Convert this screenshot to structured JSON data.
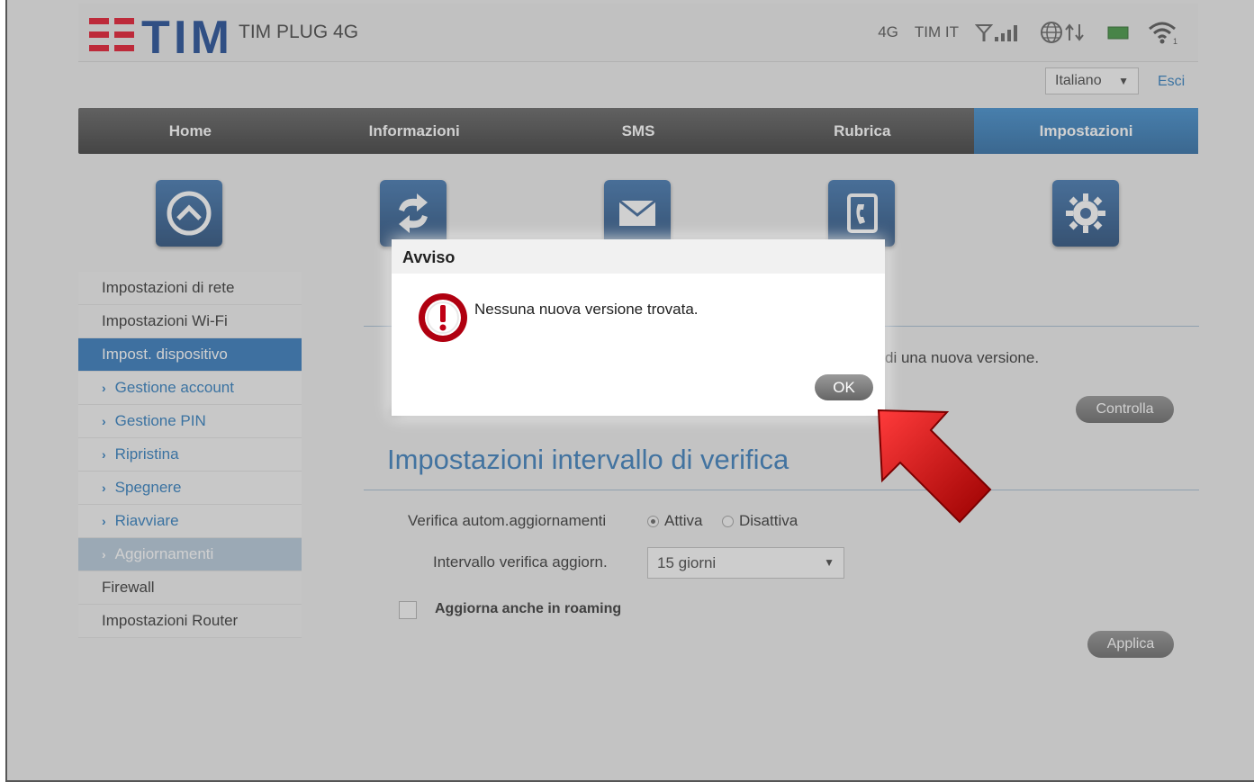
{
  "header": {
    "brand": "TIM",
    "device_name": "TIM PLUG 4G",
    "network_type": "4G",
    "operator": "TIM IT"
  },
  "language": {
    "selected": "Italiano",
    "logout": "Esci"
  },
  "nav": {
    "items": [
      {
        "label": "Home"
      },
      {
        "label": "Informazioni"
      },
      {
        "label": "SMS"
      },
      {
        "label": "Rubrica"
      },
      {
        "label": "Impostazioni"
      }
    ],
    "active": "Impostazioni"
  },
  "sidebar": {
    "items": [
      {
        "label": "Impostazioni di rete"
      },
      {
        "label": "Impostazioni Wi-Fi"
      },
      {
        "label": "Impost. dispositivo"
      },
      {
        "label": "Gestione account"
      },
      {
        "label": "Gestione PIN"
      },
      {
        "label": "Ripristina"
      },
      {
        "label": "Spegnere"
      },
      {
        "label": "Riavviare"
      },
      {
        "label": "Aggiornamenti"
      },
      {
        "label": "Firewall"
      },
      {
        "label": "Impostazioni Router"
      }
    ]
  },
  "main": {
    "check_text": "di una nuova versione.",
    "check_button": "Controlla",
    "section_title": "Impostazioni intervallo di verifica",
    "auto_update_label": "Verifica autom.aggiornamenti",
    "radio_on": "Attiva",
    "radio_off": "Disattiva",
    "interval_label": "Intervallo verifica aggiorn.",
    "interval_value": "15 giorni",
    "roaming_label": "Aggiorna anche in roaming",
    "apply_button": "Applica"
  },
  "dialog": {
    "title": "Avviso",
    "message": "Nessuna nuova versione trovata.",
    "ok": "OK"
  },
  "colors": {
    "accent": "#1f6cb5",
    "brand_red": "#e2001a",
    "annotation_arrow": "#cc0000"
  }
}
